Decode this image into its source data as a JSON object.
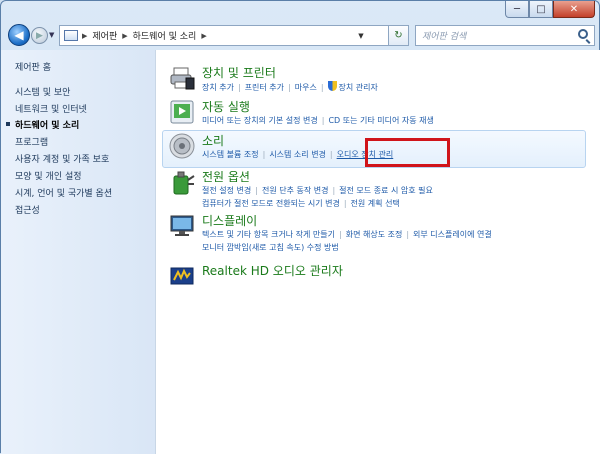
{
  "window": {
    "minimize_label": "─",
    "maximize_label": "□",
    "close_label": "✕"
  },
  "nav": {
    "back_glyph": "◀",
    "forward_glyph": "▶",
    "breadcrumb": [
      "제어판",
      "하드웨어 및 소리"
    ],
    "separator": "▶",
    "refresh_glyph": "↻",
    "search_placeholder": "제어판 검색"
  },
  "sidebar": {
    "items": [
      {
        "label": "제어판 홈"
      },
      {
        "label": "시스템 및 보안"
      },
      {
        "label": "네트워크 및 인터넷"
      },
      {
        "label": "하드웨어 및 소리"
      },
      {
        "label": "프로그램"
      },
      {
        "label": "사용자 계정 및 가족 보호"
      },
      {
        "label": "모양 및 개인 설정"
      },
      {
        "label": "시계, 언어 및 국가별 옵션"
      },
      {
        "label": "접근성"
      }
    ]
  },
  "categories": [
    {
      "title": "장치 및 프린터",
      "icon": "printer-icon",
      "link_rows": [
        [
          "장치 추가",
          "프린터 추가",
          "마우스",
          "장치 관리자"
        ]
      ]
    },
    {
      "title": "자동 실행",
      "icon": "autoplay-icon",
      "link_rows": [
        [
          "미디어 또는 장치의 기본 설정 변경",
          "CD 또는 기타 미디어 자동 재생"
        ]
      ]
    },
    {
      "title": "소리",
      "icon": "speaker-icon",
      "link_rows": [
        [
          "시스템 볼륨 조정",
          "시스템 소리 변경",
          "오디오 장치 관리"
        ]
      ]
    },
    {
      "title": "전원 옵션",
      "icon": "power-icon",
      "link_rows": [
        [
          "절전 설정 변경",
          "전원 단추 동작 변경",
          "절전 모드 종료 시 암호 필요"
        ],
        [
          "컴퓨터가 절전 모드로 전환되는 시기 변경",
          "전원 계획 선택"
        ]
      ]
    },
    {
      "title": "디스플레이",
      "icon": "display-icon",
      "link_rows": [
        [
          "텍스트 및 기타 항목 크거나 작게 만들기",
          "화면 해상도 조정",
          "외부 디스플레이에 연결"
        ],
        [
          "모니터 깜박임(새로 고침 속도) 수정 방법"
        ]
      ]
    },
    {
      "title": "Realtek HD 오디오 관리자",
      "icon": "realtek-icon",
      "link_rows": []
    }
  ],
  "highlight": {
    "color": "#d0141a"
  }
}
